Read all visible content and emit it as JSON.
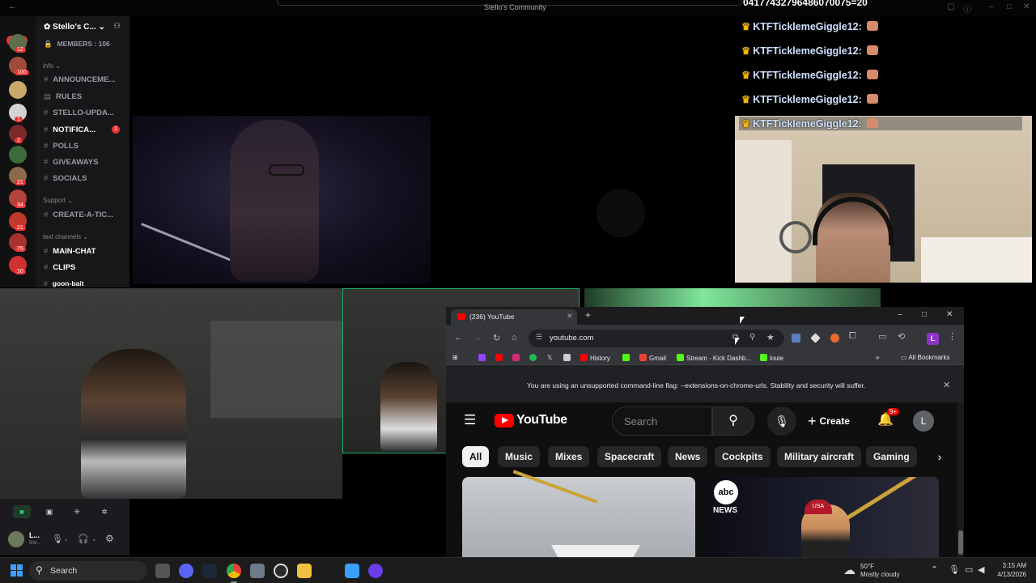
{
  "top_bar": {
    "title": "Stello's Community",
    "chat_header_fragment": "04177432796486070075=20"
  },
  "discord": {
    "rail": {
      "new_label": "NEW",
      "badges": [
        "12",
        "100",
        "1",
        "2",
        "21",
        "34",
        "21",
        "75",
        "10"
      ]
    },
    "server_name": "Stello's C...",
    "members_label": "MEMBERS : 106",
    "categories": {
      "info": "info",
      "support": "Support",
      "text_channels": "text channels"
    },
    "channels": [
      {
        "name": "ANNOUNCEME...",
        "state": "muted"
      },
      {
        "name": "RULES",
        "state": "muted"
      },
      {
        "name": "STELLO-UPDA...",
        "state": "muted"
      },
      {
        "name": "NOTIFICA...",
        "state": "unread",
        "mentions": "1"
      },
      {
        "name": "POLLS",
        "state": "muted"
      },
      {
        "name": "GIVEAWAYS",
        "state": "muted"
      },
      {
        "name": "SOCIALS",
        "state": "muted"
      },
      {
        "name": "CREATE-A-TIC...",
        "state": "muted"
      },
      {
        "name": "MAIN-CHAT",
        "state": "unread"
      },
      {
        "name": "CLIPS",
        "state": "unread"
      },
      {
        "name": "goon-bait",
        "state": "unread"
      }
    ],
    "user": {
      "name": "L...",
      "status": "Inv..."
    }
  },
  "chat": {
    "messages": [
      {
        "user": "KTFTicklemeGiggle12:",
        "highlighted": false
      },
      {
        "user": "KTFTicklemeGiggle12:",
        "highlighted": false
      },
      {
        "user": "KTFTicklemeGiggle12:",
        "highlighted": false
      },
      {
        "user": "KTFTicklemeGiggle12:",
        "highlighted": false
      },
      {
        "user": "KTFTicklemeGiggle12:",
        "highlighted": true
      }
    ],
    "crown_icon": "crown-icon",
    "hand_icon": "hand-emote-icon"
  },
  "browser": {
    "tab_title": "(236) YouTube",
    "url": "youtube.com",
    "bookmarks": [
      "History",
      "Gmail",
      "Stream - Kick Dashb...",
      "louie"
    ],
    "all_bookmarks": "All Bookmarks",
    "profile_initial": "L",
    "warning": "You are using an unsupported command-line flag: --extensions-on-chrome-urls. Stability and security will suffer."
  },
  "youtube": {
    "logo_text": "YouTube",
    "search_placeholder": "Search",
    "create_label": "Create",
    "notifications": "9+",
    "avatar_initial": "L",
    "chips": [
      "All",
      "Music",
      "Mixes",
      "Spacecraft",
      "News",
      "Cockpits",
      "Military aircraft",
      "Gaming"
    ],
    "active_chip": "All",
    "thumb2": {
      "brand_top": "abc",
      "brand_bottom": "NEWS",
      "hat_text": "USA"
    }
  },
  "taskbar": {
    "search_label": "Search",
    "weather_temp": "50°F",
    "weather_desc": "Mostly cloudy",
    "time": "3:15 AM",
    "date": "4/13/2026"
  },
  "colors": {
    "youtube_red": "#ff0000",
    "discord_bg": "#17171a",
    "chat_text": "#cfe3ff",
    "windows_accent": "#3aa0ff"
  }
}
